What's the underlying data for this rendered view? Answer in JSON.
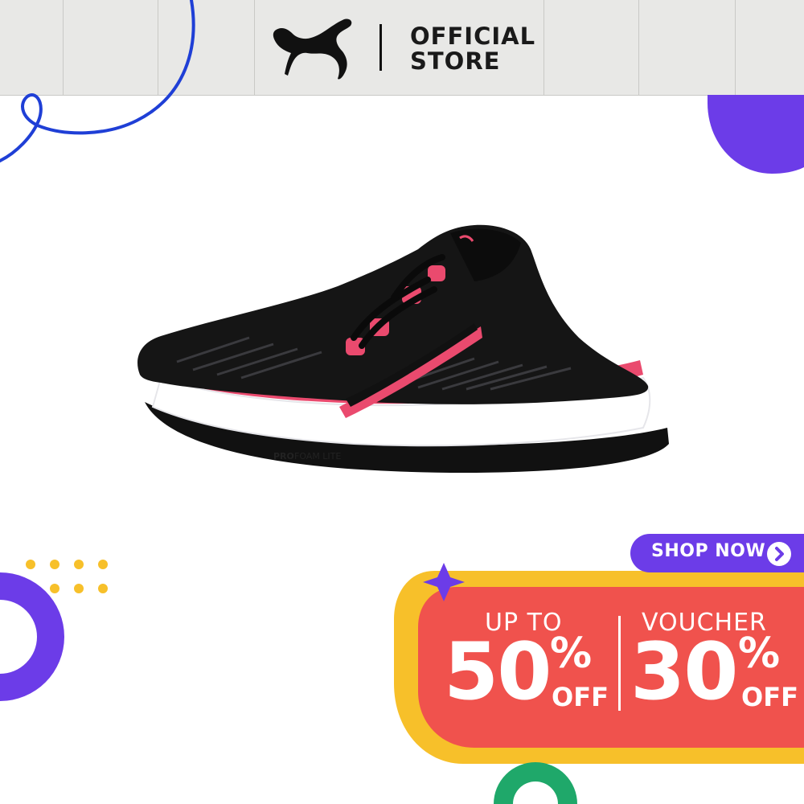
{
  "header": {
    "brand": "PUMA",
    "store_line1": "OFFICIAL",
    "store_line2": "STORE"
  },
  "product": {
    "midsole_text_bold": "PRO",
    "midsole_text": "FOAM LITE"
  },
  "promo": {
    "left_top": "UP TO",
    "left_value": "50",
    "left_percent": "%",
    "left_off": "OFF",
    "right_top": "VOUCHER",
    "right_value": "30",
    "right_percent": "%",
    "right_off": "OFF",
    "shop_button": "SHOP NOW"
  },
  "icons": {
    "brand_logo": "puma-cat-icon",
    "shop_arrow": "chevron-right-icon"
  },
  "colors": {
    "header_bg": "#e8e8e6",
    "purple": "#6c3ce8",
    "banner_red": "#f0524d",
    "banner_yellow": "#f7c02a",
    "accent_green": "#1fa86a",
    "blue_line": "#1f3fd6",
    "shoe_pink": "#ea4a6e"
  }
}
